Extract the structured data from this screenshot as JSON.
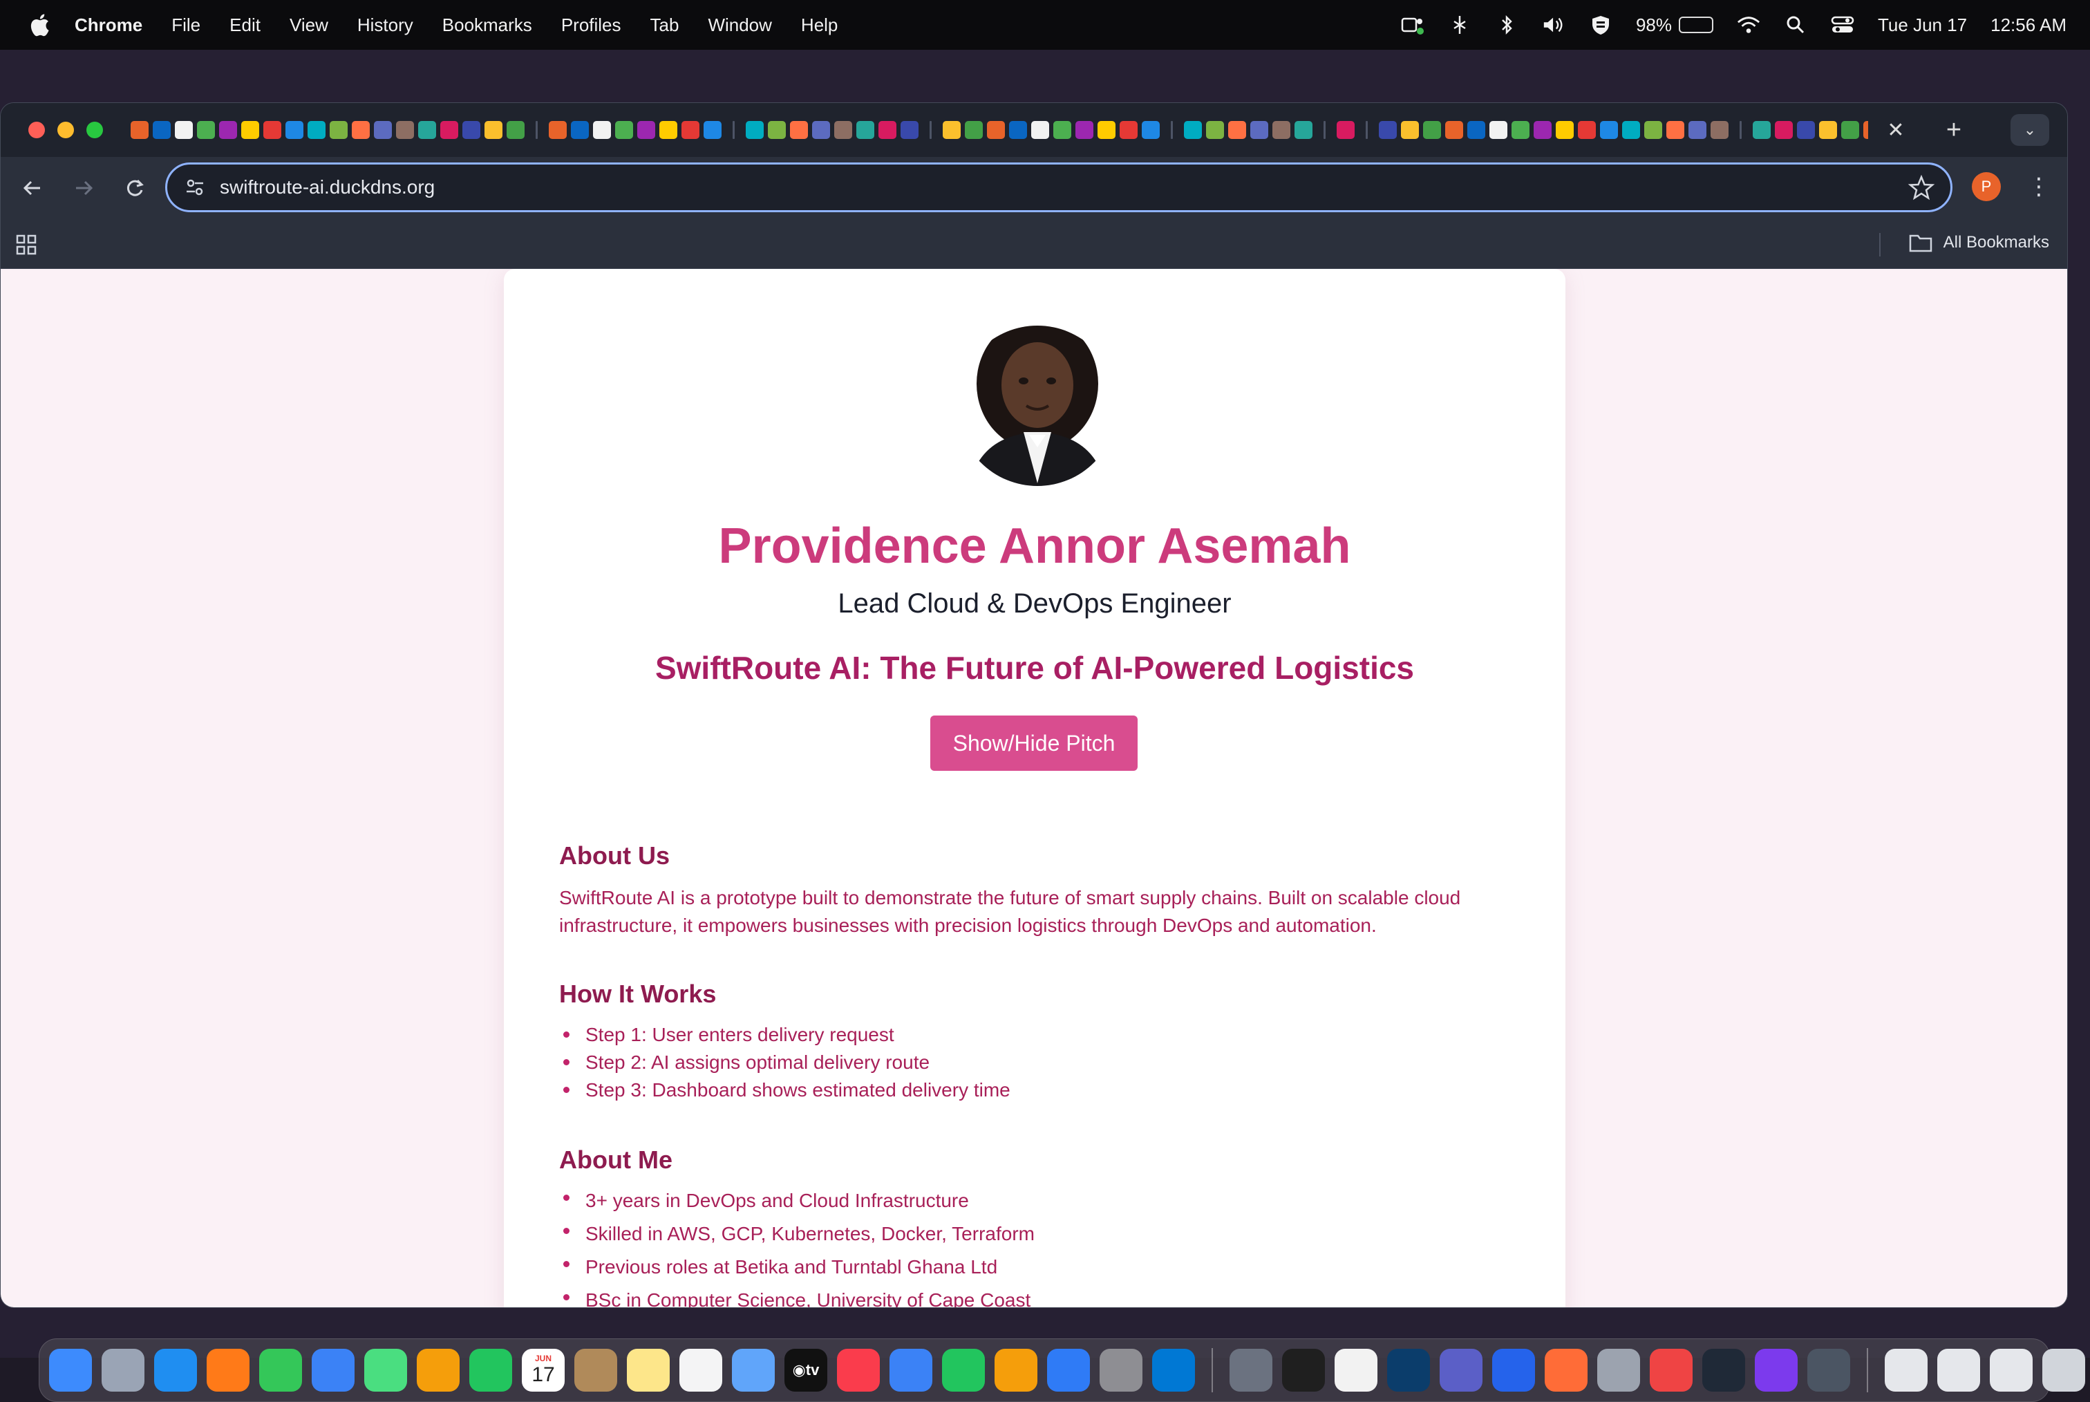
{
  "menubar": {
    "app_name": "Chrome",
    "items": [
      "File",
      "Edit",
      "View",
      "History",
      "Bookmarks",
      "Profiles",
      "Tab",
      "Window",
      "Help"
    ],
    "battery_percent": "98%",
    "battery_level": 0.98,
    "date": "Tue Jun 17",
    "time": "12:56 AM"
  },
  "browser": {
    "url": "swiftroute-ai.duckdns.org",
    "profile_initial": "P",
    "all_bookmarks_label": "All Bookmarks",
    "colors": {
      "accent": "#8fb3ff",
      "profile": "#e8632a"
    }
  },
  "page": {
    "name": "Providence Annor Asemah",
    "role": "Lead Cloud & DevOps Engineer",
    "tagline": "SwiftRoute AI: The Future of AI-Powered Logistics",
    "pitch_button": "Show/Hide Pitch",
    "about_us": {
      "title": "About Us",
      "text": "SwiftRoute AI is a prototype built to demonstrate the future of smart supply chains. Built on scalable cloud infrastructure, it empowers businesses with precision logistics through DevOps and automation."
    },
    "how_it_works": {
      "title": "How It Works",
      "steps": [
        "Step 1: User enters delivery request",
        "Step 2: AI assigns optimal delivery route",
        "Step 3: Dashboard shows estimated delivery time"
      ]
    },
    "about_me": {
      "title": "About Me",
      "items": [
        "3+ years in DevOps and Cloud Infrastructure",
        "Skilled in AWS, GCP, Kubernetes, Docker, Terraform",
        "Previous roles at Betika and Turntabl Ghana Ltd",
        "BSc in Computer Science, University of Cape Coast"
      ]
    },
    "colors": {
      "primary": "#cc3b7c",
      "heading": "#8e1b4f",
      "text": "#a82058",
      "button": "#d94d8f",
      "background": "#fbf1f6"
    }
  },
  "dock": {
    "calendar_day": "17",
    "calendar_month": "JUN",
    "tv_label": "tv",
    "apps": [
      "finder-icon",
      "launchpad-icon",
      "safari-icon",
      "firefox-icon",
      "messages-icon",
      "mail-icon",
      "maps-icon",
      "photos-icon",
      "facetime-icon",
      "calendar-icon",
      "contacts-icon",
      "notes-icon",
      "reminders-icon",
      "freeform-icon",
      "tv-icon",
      "music-icon",
      "keynote-icon",
      "numbers-icon",
      "pages-icon",
      "app-store-icon",
      "system-settings-icon",
      "vscode-icon",
      "preview-icon",
      "terminal-icon",
      "chrome-icon",
      "cloud-icon",
      "teams-icon",
      "vpn-icon",
      "postman-icon",
      "printer-icon",
      "anydesk-icon",
      "activity-monitor-icon",
      "github-desktop-icon",
      "mongodb-compass-icon",
      "downloads-stack-icon",
      "documents-stack-icon",
      "screenshots-stack-icon",
      "trash-icon"
    ]
  }
}
